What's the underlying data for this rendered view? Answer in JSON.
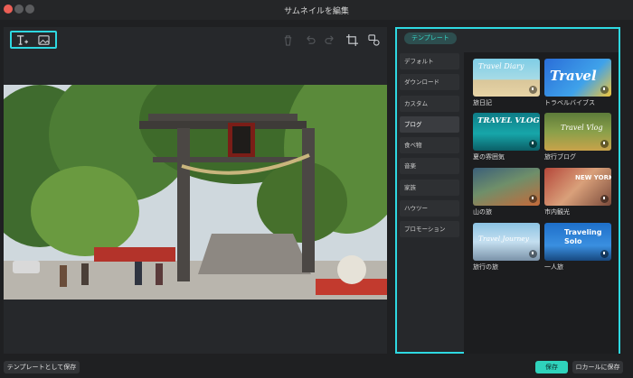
{
  "window": {
    "title": "サムネイルを編集"
  },
  "toolbar": {
    "text_tool_icon": "text-add-icon",
    "image_tool_icon": "image-icon",
    "delete_icon": "trash-icon",
    "undo_icon": "undo-icon",
    "redo_icon": "redo-icon",
    "crop_icon": "crop-icon",
    "replace_icon": "image-replace-icon"
  },
  "template_panel": {
    "tab_label": "テンプレート",
    "categories": [
      {
        "label": "デフォルト"
      },
      {
        "label": "ダウンロード"
      },
      {
        "label": "カスタム"
      },
      {
        "label": "ブログ"
      },
      {
        "label": "食べ物"
      },
      {
        "label": "音楽"
      },
      {
        "label": "家族"
      },
      {
        "label": "ハウツー"
      },
      {
        "label": "プロモーション"
      }
    ],
    "selected_category": "ブログ",
    "templates": [
      {
        "label": "旅日記",
        "art_text": "Travel Diary"
      },
      {
        "label": "トラベルバイブス",
        "art_text": "Travel"
      },
      {
        "label": "夏の雰囲気",
        "art_text": "TRAVEL VLOG"
      },
      {
        "label": "旅行ブログ",
        "art_text": "Travel Vlog"
      },
      {
        "label": "山の旅",
        "art_text": ""
      },
      {
        "label": "市内観光",
        "art_text": "NEW YORK"
      },
      {
        "label": "旅行の旅",
        "art_text": "Travel Journey"
      },
      {
        "label": "一人旅",
        "art_text": "Traveling Solo"
      }
    ]
  },
  "footer": {
    "save_as_template": "テンプレートとして保存",
    "save": "保存",
    "save_local": "ロカールに保存"
  },
  "colors": {
    "accent": "#2ed8e1",
    "save_button": "#2fd3bc",
    "panel": "#26282b",
    "background": "#1f2022"
  }
}
